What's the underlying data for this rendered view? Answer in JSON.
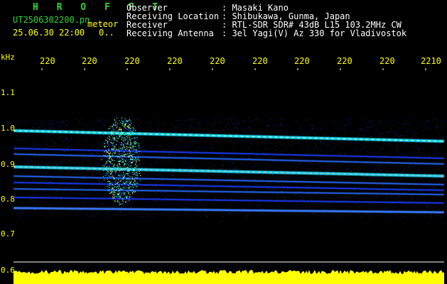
{
  "header": {
    "station": "H R O F F T",
    "filename": "UT2506302200.pn",
    "mode": "meteor",
    "datetime": "25.06.30 22:00",
    "counter": "0.."
  },
  "info": {
    "labels": [
      "Observer",
      "Receiving Location",
      "Receiver",
      "Receiving Antenna"
    ],
    "values": [
      ": Masaki Kano",
      ": Shibukawa, Gunma, Japan",
      ": RTL-SDR SDR# 43dB L15 103.2MHz CW",
      ": 3el Yagi(V) Az 330 for Vladivostok"
    ]
  },
  "axes": {
    "y_unit": "kHz",
    "y_ticks": [
      "1.1",
      "1.0",
      "0.9",
      "0.8",
      "0.7",
      "0.6"
    ],
    "x_ticks": [
      "220",
      "220",
      "220",
      "220",
      "220",
      "220",
      "220",
      "220",
      "220",
      "2210"
    ]
  },
  "colors": {
    "background": "#000000",
    "text_header": "#ffffff",
    "text_axis": "#ffff00",
    "text_station": "#35d235",
    "echo_low": "#1a3cff",
    "echo_mid": "#00e0ff",
    "echo_high": "#ff2020",
    "baseline_bar": "#ffff00"
  }
}
